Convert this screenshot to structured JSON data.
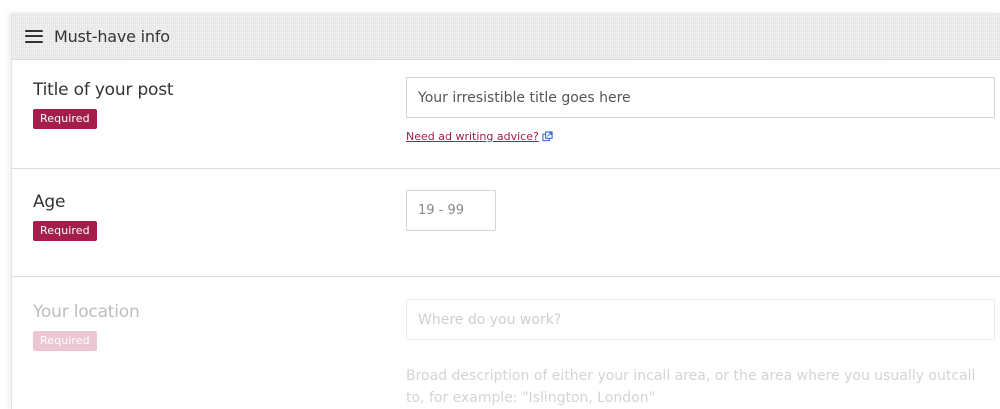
{
  "section": {
    "title": "Must-have info",
    "menu_icon": "hamburger-icon"
  },
  "fields": {
    "title": {
      "label": "Title of your post",
      "badge": "Required",
      "placeholder": "Your irresistible title goes here",
      "value": "",
      "advice_link": "Need ad writing advice?",
      "advice_icon": "external-link-icon"
    },
    "age": {
      "label": "Age",
      "badge": "Required",
      "placeholder": "19 - 99",
      "value": ""
    },
    "location": {
      "label": "Your location",
      "badge": "Required",
      "placeholder": "Where do you work?",
      "value": "",
      "help_text": "Broad description of either your incall area, or the area where you usually outcall to, for example: \"Islington, London\""
    }
  },
  "colors": {
    "accent": "#a41e4a",
    "accent_faded": "#ecc6d2",
    "header_bg": "#e2e2e2"
  }
}
